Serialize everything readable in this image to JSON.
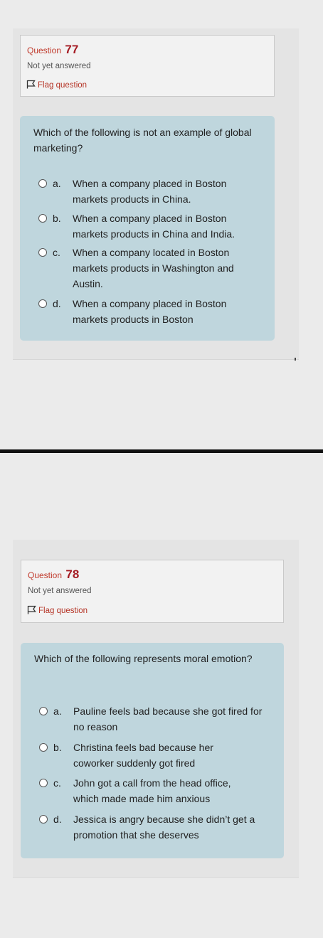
{
  "questions": [
    {
      "label": "Question",
      "number": "77",
      "state": "Not yet answered",
      "flag_label": "Flag question",
      "text": "Which of the following is not an example of global marketing?",
      "options": [
        {
          "letter": "a.",
          "text": "When a company placed in Boston markets products in China."
        },
        {
          "letter": "b.",
          "text": "When a company placed in Boston markets products in China and India."
        },
        {
          "letter": "c.",
          "text": "When a company located in Boston markets products in Washington and Austin."
        },
        {
          "letter": "d.",
          "text": "When a company placed in Boston markets products in Boston"
        }
      ]
    },
    {
      "label": "Question",
      "number": "78",
      "state": "Not yet answered",
      "flag_label": "Flag question",
      "text": "Which of the following represents moral emotion?",
      "options": [
        {
          "letter": "a.",
          "text": "Pauline feels bad because she got fired for no reason"
        },
        {
          "letter": "b.",
          "text": "Christina feels bad because her coworker suddenly got fired"
        },
        {
          "letter": "c.",
          "text": "John got a call from the head office, which made made him anxious"
        },
        {
          "letter": "d.",
          "text": "Jessica is angry because she didn’t get a promotion that she deserves"
        }
      ]
    }
  ]
}
